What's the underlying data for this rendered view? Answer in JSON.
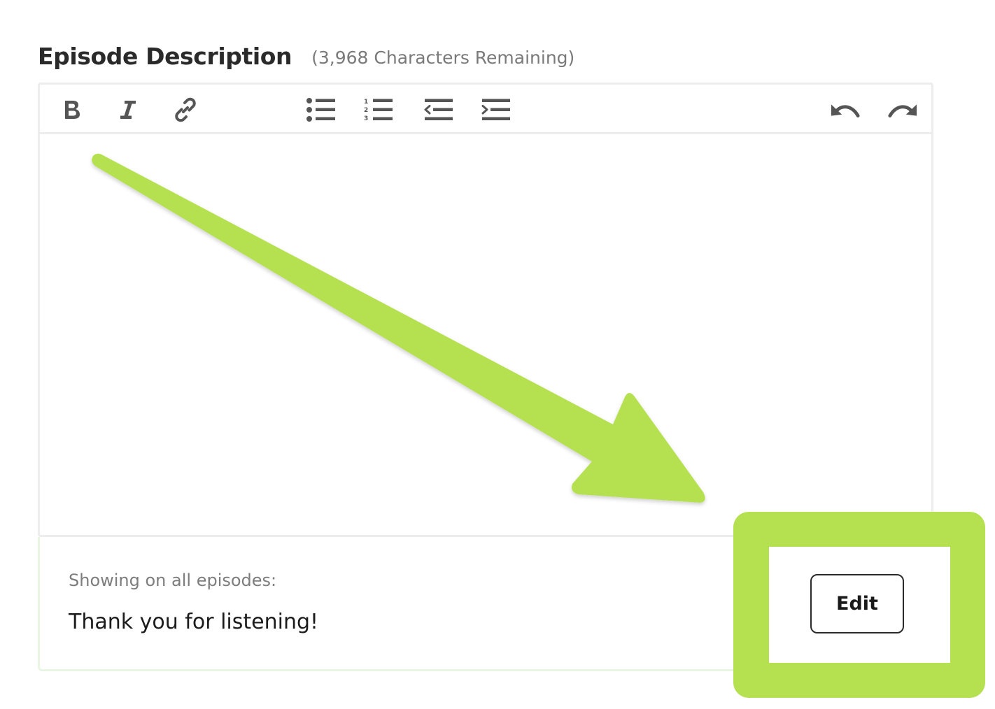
{
  "heading": {
    "title": "Episode Description",
    "remaining": "(3,968 Characters Remaining)"
  },
  "toolbar": {
    "buttons": [
      {
        "name": "bold",
        "icon": "bold-icon"
      },
      {
        "name": "italic",
        "icon": "italic-icon"
      },
      {
        "name": "link",
        "icon": "link-icon"
      },
      {
        "name": "bulleted-list",
        "icon": "bulleted-list-icon"
      },
      {
        "name": "numbered-list",
        "icon": "numbered-list-icon"
      },
      {
        "name": "outdent",
        "icon": "outdent-icon"
      },
      {
        "name": "indent",
        "icon": "indent-icon"
      },
      {
        "name": "undo",
        "icon": "undo-icon"
      },
      {
        "name": "redo",
        "icon": "redo-icon"
      }
    ]
  },
  "editor": {
    "content": ""
  },
  "footer": {
    "showing_label": "Showing on all episodes:",
    "showing_text": "Thank you for listening!",
    "edit_label": "Edit"
  },
  "annotation": {
    "arrow_icon": "annotation-arrow-icon",
    "highlight_color": "#b5e04f"
  },
  "colors": {
    "icon": "#555555",
    "border": "#ededed",
    "footer_border": "#eaf6e4"
  }
}
